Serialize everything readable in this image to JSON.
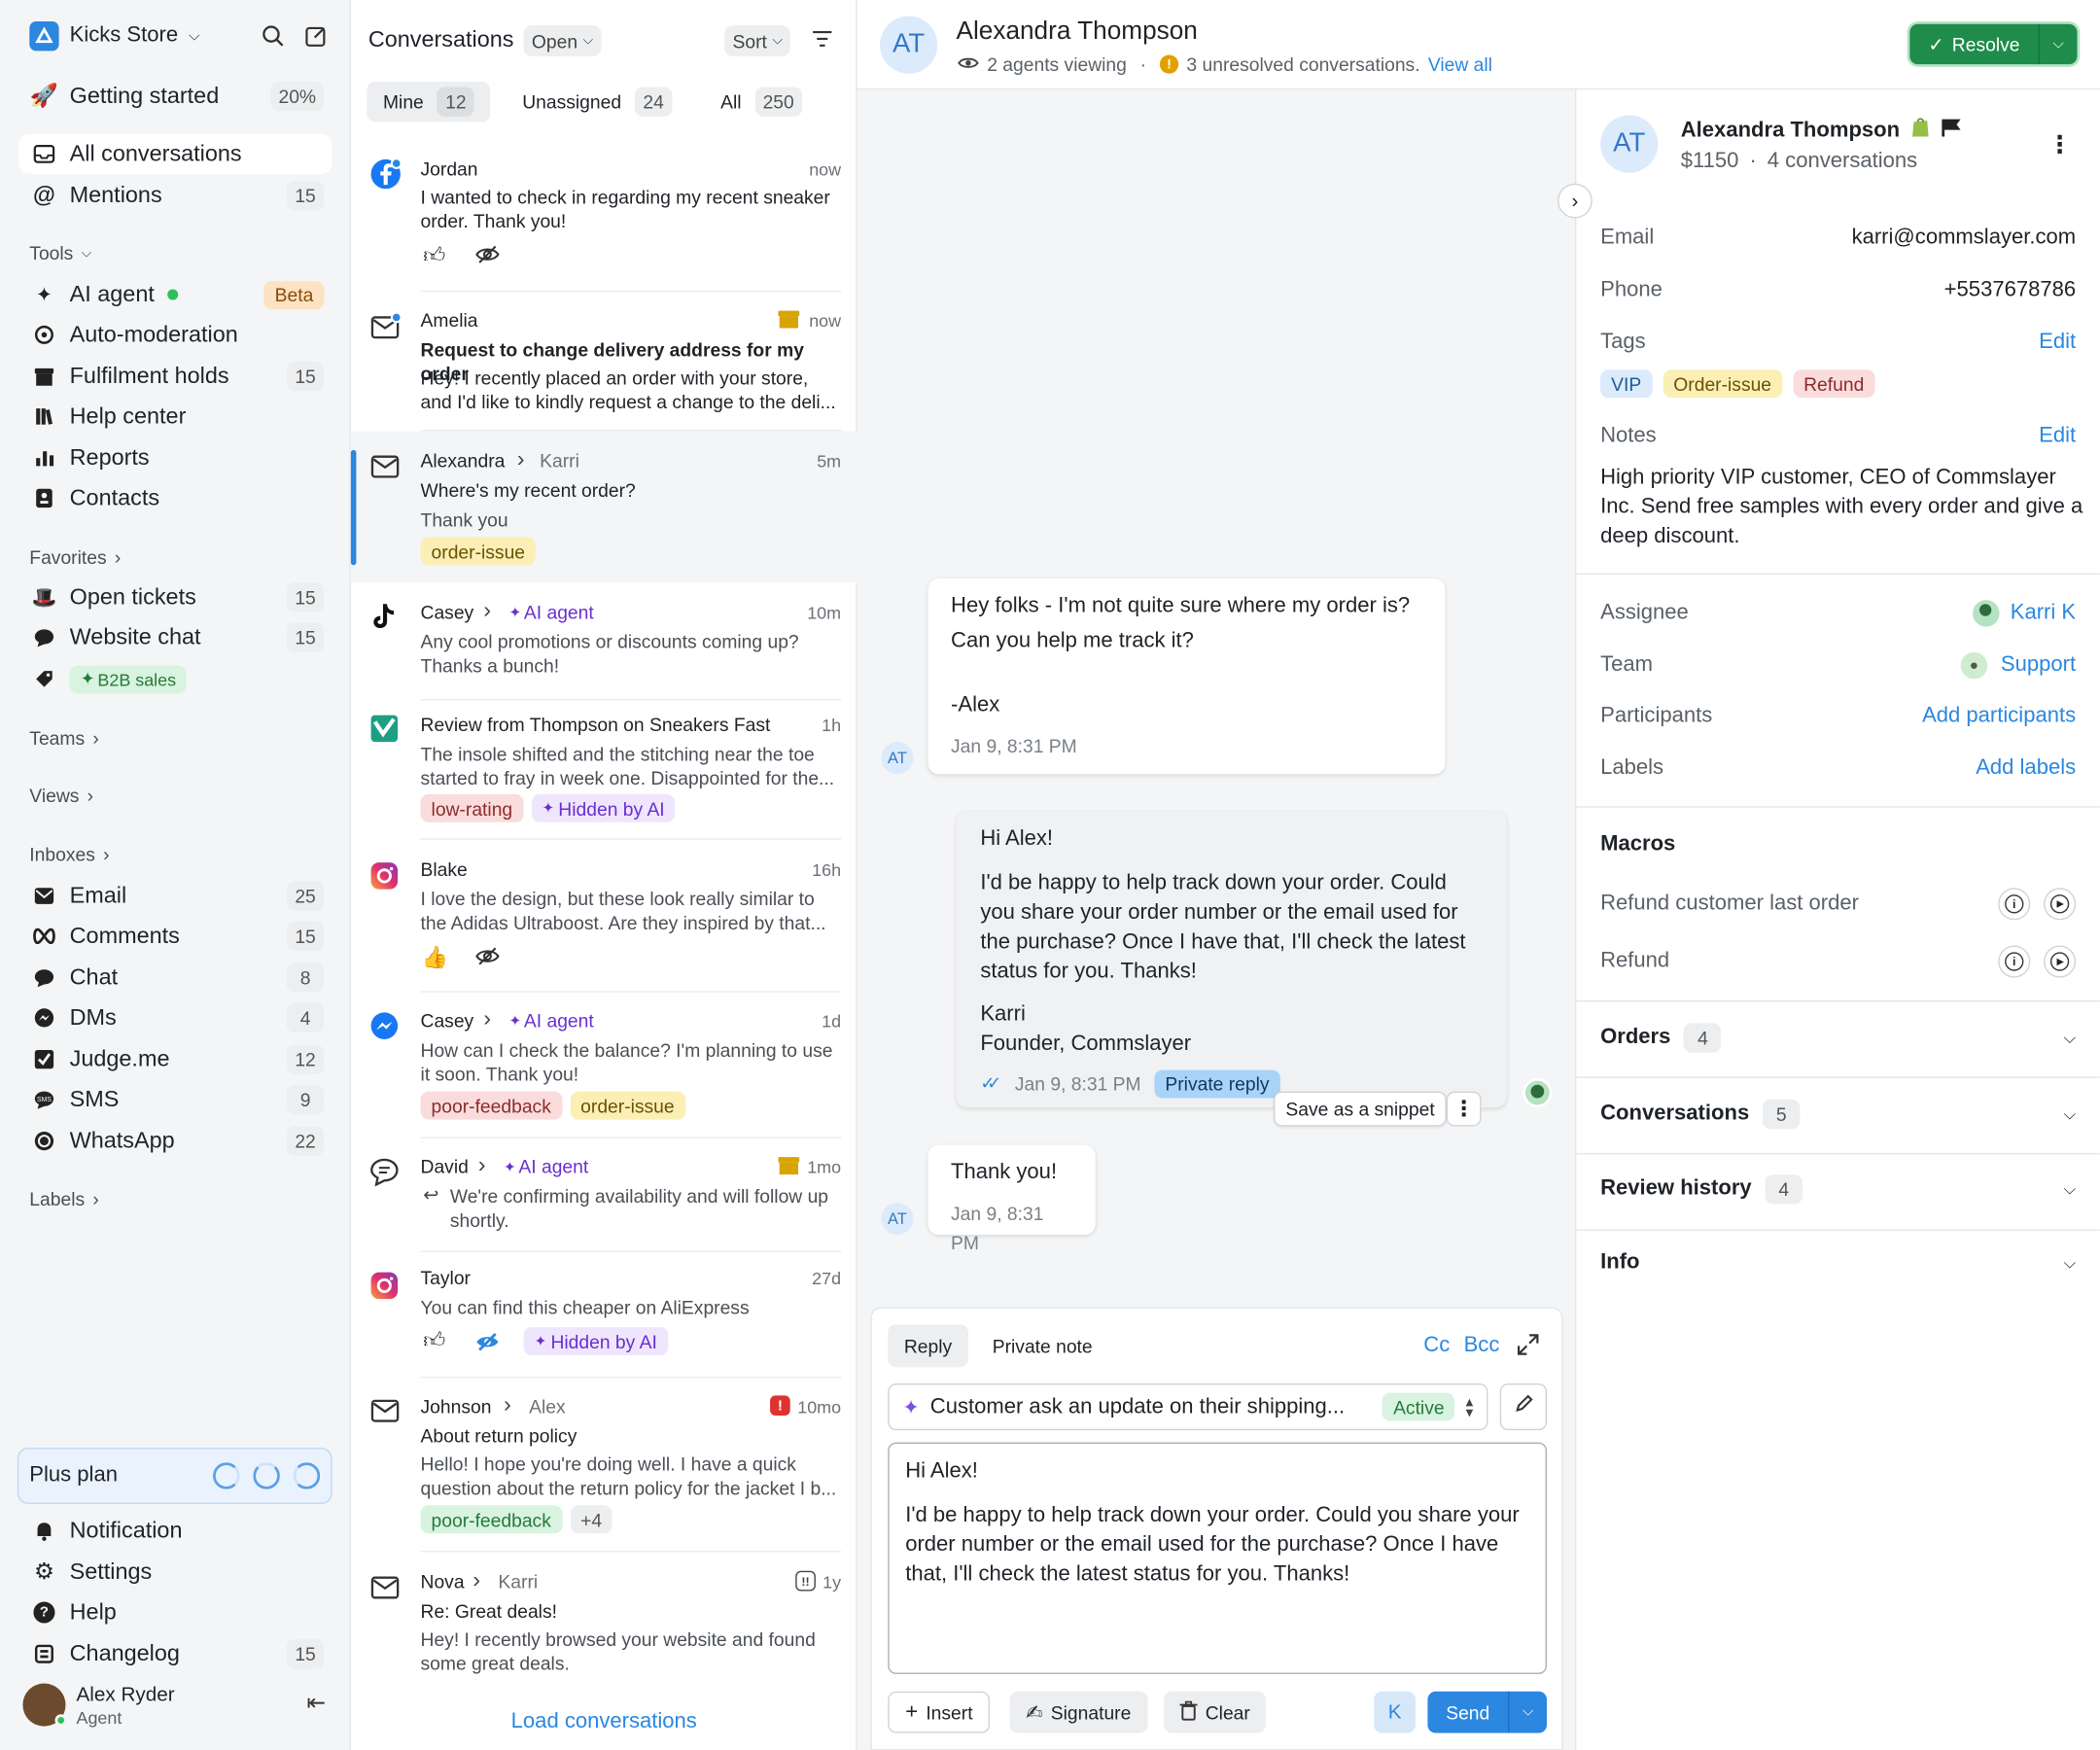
{
  "sidebar": {
    "store_name": "Kicks Store",
    "getting_started": {
      "label": "Getting started",
      "progress": "20%"
    },
    "primary": [
      {
        "label": "All conversations",
        "active": true
      },
      {
        "label": "Mentions",
        "count": "15"
      }
    ],
    "tools_label": "Tools",
    "tools": [
      {
        "label": "AI agent",
        "badge": "Beta"
      },
      {
        "label": "Auto-moderation"
      },
      {
        "label": "Fulfilment holds",
        "count": "15"
      },
      {
        "label": "Help center"
      },
      {
        "label": "Reports"
      },
      {
        "label": "Contacts"
      }
    ],
    "favorites_label": "Favorites",
    "favorites": [
      {
        "label": "Open tickets",
        "count": "15"
      },
      {
        "label": "Website chat",
        "count": "15"
      },
      {
        "label": "B2B sales"
      }
    ],
    "teams_label": "Teams",
    "views_label": "Views",
    "inboxes_label": "Inboxes",
    "inboxes": [
      {
        "label": "Email",
        "count": "25"
      },
      {
        "label": "Comments",
        "count": "15"
      },
      {
        "label": "Chat",
        "count": "8"
      },
      {
        "label": "DMs",
        "count": "4"
      },
      {
        "label": "Judge.me",
        "count": "12"
      },
      {
        "label": "SMS",
        "count": "9"
      },
      {
        "label": "WhatsApp",
        "count": "22"
      }
    ],
    "labels_label": "Labels",
    "plan": "Plus plan",
    "bottom": [
      {
        "label": "Notification"
      },
      {
        "label": "Settings"
      },
      {
        "label": "Help"
      },
      {
        "label": "Changelog",
        "count": "15"
      }
    ],
    "user": {
      "name": "Alex Ryder",
      "role": "Agent"
    }
  },
  "convlist": {
    "title": "Conversations",
    "status": "Open",
    "sort": "Sort",
    "tabs": [
      {
        "label": "Mine",
        "count": "12"
      },
      {
        "label": "Unassigned",
        "count": "24"
      },
      {
        "label": "All",
        "count": "250"
      }
    ],
    "items": [
      {
        "name": "Jordan",
        "time": "now",
        "text": "I wanted to check in regarding my recent sneaker order. Thank you!"
      },
      {
        "name": "Amelia",
        "time": "now",
        "subject": "Request to change delivery address for my order",
        "text": "Hey! I recently placed an order with your store, and I'd like to kindly request a change to the deli..."
      },
      {
        "name": "Alexandra",
        "to": "Karri",
        "time": "5m",
        "text": "Where's my recent order?",
        "text2": "Thank you",
        "tags": [
          "order-issue"
        ]
      },
      {
        "name": "Casey",
        "to": "AI agent",
        "time": "10m",
        "text": "Any cool promotions or discounts coming up? Thanks a bunch!"
      },
      {
        "name": "Review from Thompson on Sneakers Fast",
        "time": "1h",
        "text": "The insole shifted and the stitching near the toe started to fray in week one. Disappointed for the...",
        "tags": [
          "low-rating",
          "Hidden by AI"
        ]
      },
      {
        "name": "Blake",
        "time": "16h",
        "text": "I love the design, but these look really similar to the Adidas Ultraboost. Are they inspired by that..."
      },
      {
        "name": "Casey",
        "to": "AI agent",
        "time": "1d",
        "text": "How can I check the balance? I'm planning to use it soon. Thank you!",
        "tags": [
          "poor-feedback",
          "order-issue"
        ]
      },
      {
        "name": "David",
        "to": "AI agent",
        "time": "1mo",
        "text": "We're confirming availability and will follow up shortly."
      },
      {
        "name": "Taylor",
        "time": "27d",
        "text": "You can find this cheaper on AliExpress",
        "tags": [
          "Hidden by AI"
        ]
      },
      {
        "name": "Johnson",
        "to": "Alex",
        "time": "10mo",
        "subject": "About return policy",
        "text": "Hello! I hope you're doing well. I have a quick question about the return policy for the jacket I b...",
        "tags": [
          "poor-feedback",
          "+4"
        ]
      },
      {
        "name": "Nova",
        "to": "Karri",
        "time": "1y",
        "subject": "Re: Great deals!",
        "text": "Hey! I recently browsed your website and found some great deals."
      }
    ],
    "load_more": "Load conversations"
  },
  "header": {
    "initials": "AT",
    "name": "Alexandra Thompson",
    "viewing": "2 agents viewing",
    "unresolved": "3 unresolved conversations.",
    "view_all": "View all",
    "resolve": "Resolve"
  },
  "thread": {
    "msg1": {
      "l1": "Hey folks - I'm not quite sure where my order is?",
      "l2": "Can you help me track it?",
      "l3": "-Alex",
      "time": "Jan 9, 8:31 PM",
      "initials": "AT"
    },
    "msg2": {
      "greet": "Hi Alex!",
      "body": "I'd be happy to help track down your order. Could you share your order number or the email used for the purchase? Once I have that, I'll check the latest status for you. Thanks!",
      "sig1": "Karri",
      "sig2": "Founder, Commslayer",
      "time": "Jan 9, 8:31 PM",
      "badge": "Private reply",
      "snippet": "Save as a snippet"
    },
    "msg3": {
      "text": "Thank you!",
      "time": "Jan 9, 8:31 PM",
      "initials": "AT"
    }
  },
  "composer": {
    "tab_reply": "Reply",
    "tab_note": "Private note",
    "cc": "Cc",
    "bcc": "Bcc",
    "ai_text": "Customer ask an update on their shipping...",
    "ai_status": "Active",
    "greet": "Hi Alex!",
    "body": "I'd be happy to help track down your order. Could you share your order number or the email used for the purchase? Once I have that, I'll check the latest status for you. Thanks!",
    "insert": "Insert",
    "signature": "Signature",
    "clear": "Clear",
    "agent_initial": "K",
    "send": "Send"
  },
  "contact": {
    "initials": "AT",
    "name": "Alexandra Thompson",
    "value": "$1150",
    "conversations": "4 conversations",
    "email_label": "Email",
    "email": "karri@commslayer.com",
    "phone_label": "Phone",
    "phone": "+5537678786",
    "tags_label": "Tags",
    "edit": "Edit",
    "tags": [
      "VIP",
      "Order-issue",
      "Refund"
    ],
    "notes_label": "Notes",
    "notes": "High priority VIP customer, CEO of Commslayer Inc. Send free samples with every order and give a deep discount.",
    "assignee_label": "Assignee",
    "assignee": "Karri K",
    "team_label": "Team",
    "team": "Support",
    "participants_label": "Participants",
    "participants": "Add participants",
    "labels_label": "Labels",
    "labels": "Add labels",
    "macros_label": "Macros",
    "macros": [
      "Refund customer last order",
      "Refund"
    ],
    "sections": [
      {
        "label": "Orders",
        "count": "4"
      },
      {
        "label": "Conversations",
        "count": "5"
      },
      {
        "label": "Review history",
        "count": "4"
      },
      {
        "label": "Info"
      }
    ]
  }
}
